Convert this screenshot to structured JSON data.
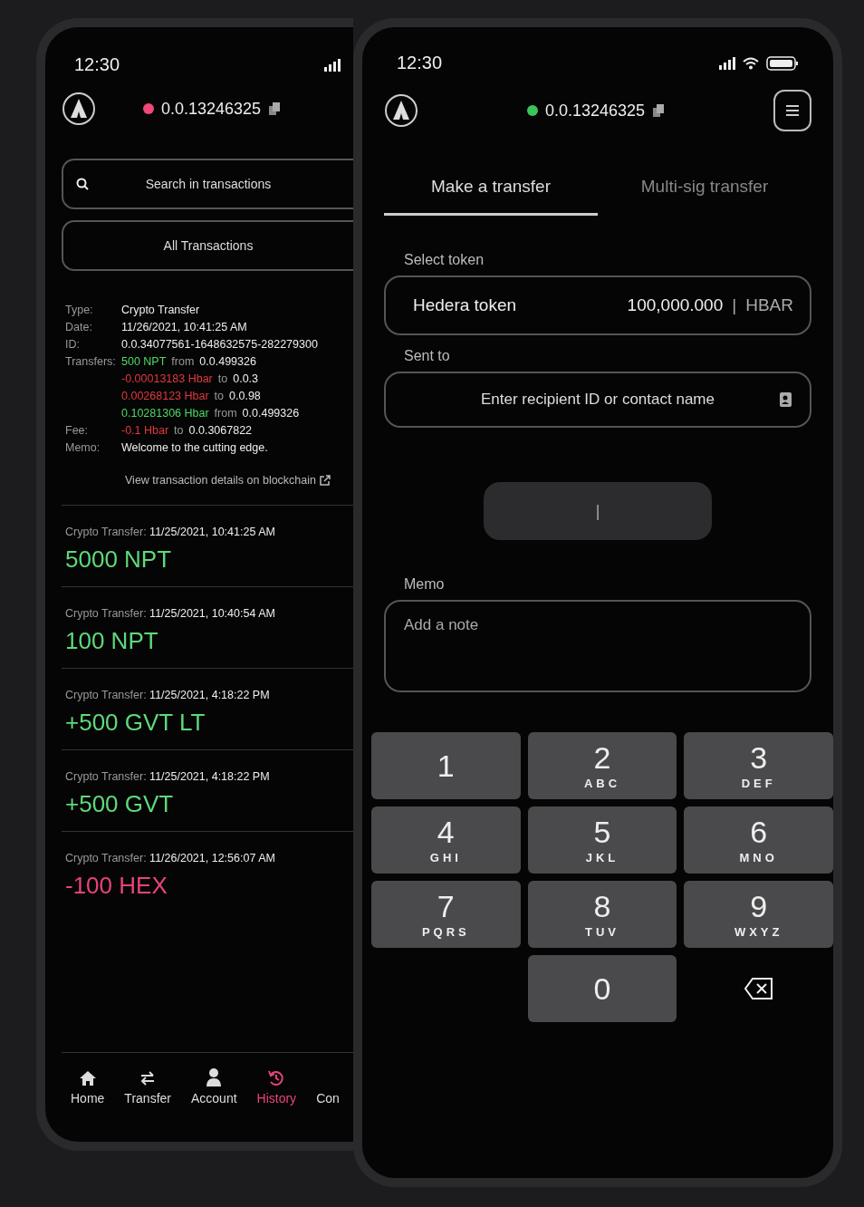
{
  "history_phone": {
    "status_bar": {
      "time": "12:30"
    },
    "header": {
      "account": "0.0.13246325",
      "status_dot": {
        "color": "#f0487a"
      }
    },
    "search": {
      "placeholder": "Search in transactions"
    },
    "filter": {
      "value": "All Transactions"
    },
    "details": {
      "fields": [
        {
          "label": "Type:",
          "parts": [
            {
              "text": "Crypto Transfer",
              "kind": "plain"
            }
          ]
        },
        {
          "label": "Date:",
          "parts": [
            {
              "text": "11/26/2021, 10:41:25 AM",
              "kind": "plain"
            }
          ]
        },
        {
          "label": "ID:",
          "parts": [
            {
              "text": "0.0.34077561-1648632575-282279300",
              "kind": "plain"
            }
          ]
        },
        {
          "label": "Transfers:",
          "parts": [
            {
              "text": "500 NPT",
              "kind": "amount",
              "color": "#4cd964"
            },
            {
              "text": "from",
              "kind": "muted"
            },
            {
              "text": "0.0.499326",
              "kind": "plain"
            }
          ]
        },
        {
          "parts": [
            {
              "text": "-0.00013183 Hbar",
              "kind": "amount",
              "color": "#e0393e"
            },
            {
              "text": "to",
              "kind": "muted"
            },
            {
              "text": "0.0.3",
              "kind": "plain"
            }
          ]
        },
        {
          "parts": [
            {
              "text": "0.00268123 Hbar",
              "kind": "amount",
              "color": "#e0393e"
            },
            {
              "text": "to",
              "kind": "muted"
            },
            {
              "text": "0.0.98",
              "kind": "plain"
            }
          ]
        },
        {
          "parts": [
            {
              "text": "0.10281306 Hbar",
              "kind": "amount",
              "color": "#4cd964"
            },
            {
              "text": "from",
              "kind": "muted"
            },
            {
              "text": "0.0.499326",
              "kind": "plain"
            }
          ]
        },
        {
          "label": "Fee:",
          "parts": [
            {
              "text": "-0.1 Hbar",
              "kind": "amount",
              "color": "#e0393e"
            },
            {
              "text": "to",
              "kind": "muted"
            },
            {
              "text": "0.0.3067822",
              "kind": "plain"
            }
          ]
        },
        {
          "label": "Memo:",
          "parts": [
            {
              "text": "Welcome to the cutting edge.",
              "kind": "plain"
            }
          ]
        }
      ],
      "link": "View transaction details on blockchain"
    },
    "transactions": [
      {
        "type": "Crypto Transfer:",
        "date": "11/25/2021, 10:41:25 AM",
        "amount": "5000 NPT",
        "color": "#5fd97a"
      },
      {
        "type": "Crypto Transfer:",
        "date": "11/25/2021, 10:40:54 AM",
        "amount": "100 NPT",
        "color": "#5fd97a"
      },
      {
        "type": "Crypto Transfer:",
        "date": "11/25/2021, 4:18:22 PM",
        "amount": "+500 GVT LT",
        "color": "#5fd97a"
      },
      {
        "type": "Crypto Transfer:",
        "date": "11/25/2021, 4:18:22 PM",
        "amount": "+500 GVT",
        "color": "#5fd97a"
      },
      {
        "type": "Crypto Transfer:",
        "date": "11/26/2021, 12:56:07 AM",
        "amount": "-100 HEX",
        "color": "#e8437a"
      }
    ],
    "nav": [
      {
        "label": "Home",
        "kind": "home",
        "selected": false
      },
      {
        "label": "Transfer",
        "kind": "transfer",
        "selected": false
      },
      {
        "label": "Account",
        "kind": "account",
        "selected": false
      },
      {
        "label": "History",
        "kind": "history",
        "selected": true
      },
      {
        "label": "Con",
        "kind": "none",
        "selected": false
      }
    ]
  },
  "transfer_phone": {
    "status_bar": {
      "time": "12:30"
    },
    "header": {
      "account": "0.0.13246325",
      "status_dot": {
        "color": "#3cc35a"
      }
    },
    "tabs": [
      {
        "label": "Make a transfer",
        "selected": true
      },
      {
        "label": "Multi-sig transfer",
        "selected": false
      }
    ],
    "token": {
      "label": "Select token",
      "name": "Hedera token",
      "balance": "100,000.000",
      "separator": "|",
      "symbol": "HBAR"
    },
    "recipient": {
      "label": "Sent to",
      "placeholder": "Enter recipient ID or contact name"
    },
    "amount_button": {
      "text": "|"
    },
    "memo": {
      "label": "Memo",
      "placeholder": "Add a note"
    },
    "keypad": [
      {
        "digit": "1"
      },
      {
        "digit": "2",
        "letters": "ABC"
      },
      {
        "digit": "3",
        "letters": "DEF"
      },
      {
        "digit": "4",
        "letters": "GHI"
      },
      {
        "digit": "5",
        "letters": "JKL"
      },
      {
        "digit": "6",
        "letters": "MNO"
      },
      {
        "digit": "7",
        "letters": "PQRS"
      },
      {
        "digit": "8",
        "letters": "TUV"
      },
      {
        "digit": "9",
        "letters": "WXYZ"
      },
      {
        "kind": "blank"
      },
      {
        "digit": "0"
      },
      {
        "kind": "backspace"
      }
    ]
  }
}
